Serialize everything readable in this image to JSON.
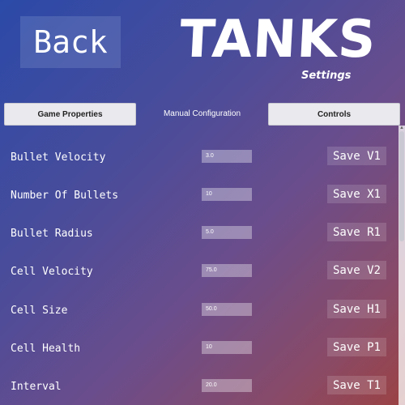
{
  "header": {
    "back_label": "Back",
    "title": "TANKS",
    "subtitle": "Settings"
  },
  "tabs": [
    {
      "label": "Game Properties",
      "active": false
    },
    {
      "label": "Manual Configuration",
      "active": true
    },
    {
      "label": "Controls",
      "active": false
    }
  ],
  "rows": [
    {
      "label": "Bullet Velocity",
      "value": "3.0",
      "button": "Save V1"
    },
    {
      "label": "Number Of Bullets",
      "value": "10",
      "button": "Save X1"
    },
    {
      "label": "Bullet Radius",
      "value": "5.0",
      "button": "Save R1"
    },
    {
      "label": "Cell Velocity",
      "value": "75.0",
      "button": "Save V2"
    },
    {
      "label": "Cell Size",
      "value": "50.0",
      "button": "Save H1"
    },
    {
      "label": "Cell Health",
      "value": "10",
      "button": "Save P1"
    },
    {
      "label": "Interval",
      "value": "20.0",
      "button": "Save T1"
    }
  ]
}
